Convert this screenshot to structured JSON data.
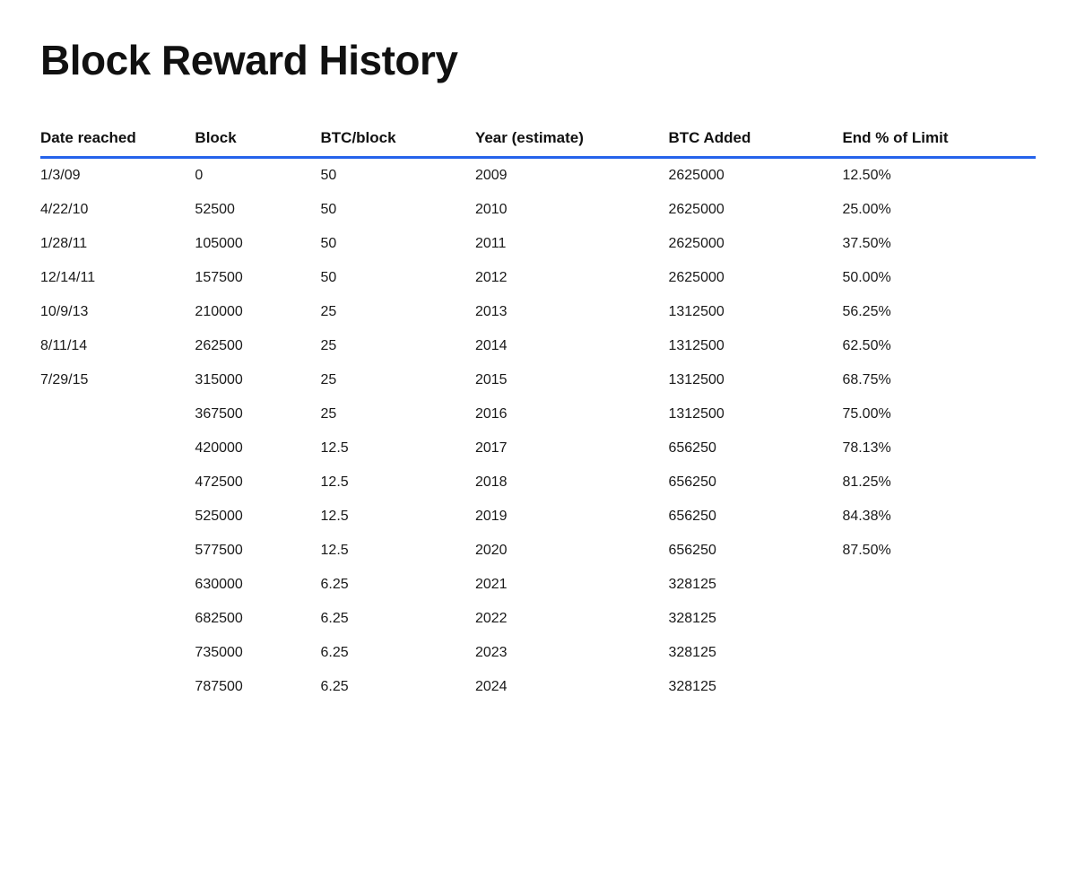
{
  "page": {
    "title": "Block Reward History"
  },
  "table": {
    "headers": [
      "Date reached",
      "Block",
      "BTC/block",
      "Year (estimate)",
      "BTC Added",
      "End % of Limit"
    ],
    "rows": [
      {
        "date": "1/3/09",
        "block": "0",
        "btc_block": "50",
        "year": "2009",
        "btc_added": "2625000",
        "end_pct": "12.50%"
      },
      {
        "date": "4/22/10",
        "block": "52500",
        "btc_block": "50",
        "year": "2010",
        "btc_added": "2625000",
        "end_pct": "25.00%"
      },
      {
        "date": "1/28/11",
        "block": "105000",
        "btc_block": "50",
        "year": "2011",
        "btc_added": "2625000",
        "end_pct": "37.50%"
      },
      {
        "date": "12/14/11",
        "block": "157500",
        "btc_block": "50",
        "year": "2012",
        "btc_added": "2625000",
        "end_pct": "50.00%"
      },
      {
        "date": "10/9/13",
        "block": "210000",
        "btc_block": "25",
        "year": "2013",
        "btc_added": "1312500",
        "end_pct": "56.25%"
      },
      {
        "date": "8/11/14",
        "block": "262500",
        "btc_block": "25",
        "year": "2014",
        "btc_added": "1312500",
        "end_pct": "62.50%"
      },
      {
        "date": "7/29/15",
        "block": "315000",
        "btc_block": "25",
        "year": "2015",
        "btc_added": "1312500",
        "end_pct": "68.75%"
      },
      {
        "date": "",
        "block": "367500",
        "btc_block": "25",
        "year": "2016",
        "btc_added": "1312500",
        "end_pct": "75.00%"
      },
      {
        "date": "",
        "block": "420000",
        "btc_block": "12.5",
        "year": "2017",
        "btc_added": "656250",
        "end_pct": "78.13%"
      },
      {
        "date": "",
        "block": "472500",
        "btc_block": "12.5",
        "year": "2018",
        "btc_added": "656250",
        "end_pct": "81.25%"
      },
      {
        "date": "",
        "block": "525000",
        "btc_block": "12.5",
        "year": "2019",
        "btc_added": "656250",
        "end_pct": "84.38%"
      },
      {
        "date": "",
        "block": "577500",
        "btc_block": "12.5",
        "year": "2020",
        "btc_added": "656250",
        "end_pct": "87.50%"
      },
      {
        "date": "",
        "block": "630000",
        "btc_block": "6.25",
        "year": "2021",
        "btc_added": "328125",
        "end_pct": ""
      },
      {
        "date": "",
        "block": "682500",
        "btc_block": "6.25",
        "year": "2022",
        "btc_added": "328125",
        "end_pct": ""
      },
      {
        "date": "",
        "block": "735000",
        "btc_block": "6.25",
        "year": "2023",
        "btc_added": "328125",
        "end_pct": ""
      },
      {
        "date": "",
        "block": "787500",
        "btc_block": "6.25",
        "year": "2024",
        "btc_added": "328125",
        "end_pct": ""
      }
    ]
  }
}
